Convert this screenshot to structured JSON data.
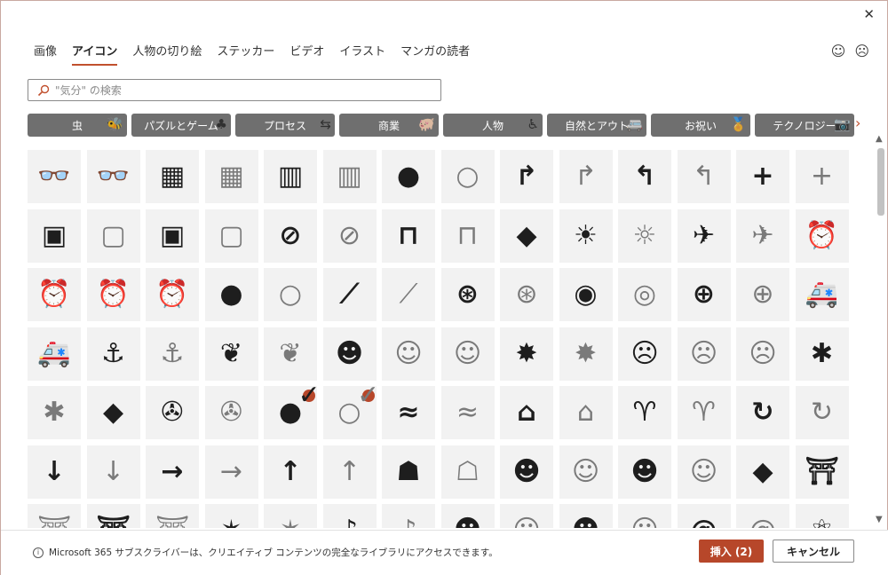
{
  "dialog": {
    "close_glyph": "✕"
  },
  "tabs": [
    {
      "label": "画像",
      "active": false
    },
    {
      "label": "アイコン",
      "active": true
    },
    {
      "label": "人物の切り絵",
      "active": false
    },
    {
      "label": "ステッカー",
      "active": false
    },
    {
      "label": "ビデオ",
      "active": false
    },
    {
      "label": "イラスト",
      "active": false
    },
    {
      "label": "マンガの読者",
      "active": false
    }
  ],
  "feedback": {
    "smile_glyph": "☺",
    "frown_glyph": "☹"
  },
  "search": {
    "icon": "search-icon",
    "placeholder": "\"気分\" の検索",
    "value": ""
  },
  "categories": [
    {
      "label": "虫",
      "icon": "bee-hive-icon",
      "glyph": "🐝"
    },
    {
      "label": "パズルとゲーム",
      "icon": "puzzle-icon",
      "glyph": "♣"
    },
    {
      "label": "プロセス",
      "icon": "process-arrows-icon",
      "glyph": "⇆"
    },
    {
      "label": "商業",
      "icon": "piggy-bank-icon",
      "glyph": "🐖"
    },
    {
      "label": "人物",
      "icon": "wheelchair-icon",
      "glyph": "♿"
    },
    {
      "label": "自然とアウト",
      "icon": "camper-icon",
      "glyph": "🚐"
    },
    {
      "label": "お祝い",
      "icon": "award-ribbon-icon",
      "glyph": "🏅"
    },
    {
      "label": "テクノロジー",
      "icon": "camera-icon",
      "glyph": "📷"
    }
  ],
  "categories_next_glyph": "›",
  "icon_grid": [
    [
      {
        "name": "3d-glasses-filled",
        "glyph": "👓",
        "style": "filled"
      },
      {
        "name": "3d-glasses-outline",
        "glyph": "👓",
        "style": "outline"
      },
      {
        "name": "abacus-filled",
        "glyph": "▦",
        "style": "filled"
      },
      {
        "name": "abacus-outline",
        "glyph": "▦",
        "style": "outline"
      },
      {
        "name": "abacus-2-filled",
        "glyph": "▥",
        "style": "filled"
      },
      {
        "name": "abacus-2-outline",
        "glyph": "▥",
        "style": "outline"
      },
      {
        "name": "acorn-filled",
        "glyph": "●",
        "style": "filled"
      },
      {
        "name": "acorn-outline",
        "glyph": "○",
        "style": "outline"
      },
      {
        "name": "arrow-turn-right-filled",
        "glyph": "↱",
        "style": "filled"
      },
      {
        "name": "arrow-turn-right-outline",
        "glyph": "↱",
        "style": "outline"
      },
      {
        "name": "arrow-turn-left-filled",
        "glyph": "↰",
        "style": "filled"
      },
      {
        "name": "arrow-turn-left-outline",
        "glyph": "↰",
        "style": "outline"
      },
      {
        "name": "add-filled",
        "glyph": "+",
        "style": "filled"
      },
      {
        "name": "add-outline",
        "glyph": "+",
        "style": "outline"
      }
    ],
    [
      {
        "name": "address-book-filled",
        "glyph": "▣",
        "style": "filled"
      },
      {
        "name": "address-book-outline",
        "glyph": "▢",
        "style": "outline"
      },
      {
        "name": "address-book-2-filled",
        "glyph": "▣",
        "style": "filled"
      },
      {
        "name": "address-book-2-outline",
        "glyph": "▢",
        "style": "outline"
      },
      {
        "name": "adhesive-bandage-filled",
        "glyph": "⊘",
        "style": "filled"
      },
      {
        "name": "adhesive-bandage-outline",
        "glyph": "⊘",
        "style": "outline"
      },
      {
        "name": "billboard-filled",
        "glyph": "⊓",
        "style": "filled"
      },
      {
        "name": "billboard-outline",
        "glyph": "⊓",
        "style": "outline"
      },
      {
        "name": "africa-filled",
        "glyph": "◆",
        "style": "filled"
      },
      {
        "name": "agriculture-filled",
        "glyph": "☀",
        "style": "filled"
      },
      {
        "name": "agriculture-outline",
        "glyph": "☼",
        "style": "outline"
      },
      {
        "name": "airplane-filled",
        "glyph": "✈",
        "style": "filled"
      },
      {
        "name": "airplane-outline",
        "glyph": "✈",
        "style": "outline"
      },
      {
        "name": "alarm-clock-filled",
        "glyph": "⏰",
        "style": "filled"
      }
    ],
    [
      {
        "name": "alarm-clock-outline",
        "glyph": "⏰",
        "style": "outline"
      },
      {
        "name": "alarm-ringing-filled",
        "glyph": "⏰",
        "style": "filled"
      },
      {
        "name": "alarm-ringing-outline",
        "glyph": "⏰",
        "style": "outline"
      },
      {
        "name": "alien-face-filled",
        "glyph": "●",
        "style": "filled"
      },
      {
        "name": "alien-face-outline",
        "glyph": "○",
        "style": "outline"
      },
      {
        "name": "needle-filled",
        "glyph": "⟋",
        "style": "filled"
      },
      {
        "name": "needle-outline",
        "glyph": "⟋",
        "style": "outline"
      },
      {
        "name": "yarn-filled",
        "glyph": "⊛",
        "style": "filled"
      },
      {
        "name": "yarn-outline",
        "glyph": "⊛",
        "style": "outline"
      },
      {
        "name": "measuring-tape-filled",
        "glyph": "◉",
        "style": "filled"
      },
      {
        "name": "measuring-tape-outline",
        "glyph": "◎",
        "style": "outline"
      },
      {
        "name": "button-filled",
        "glyph": "⊕",
        "style": "filled"
      },
      {
        "name": "button-outline",
        "glyph": "⊕",
        "style": "outline"
      },
      {
        "name": "ambulance-filled",
        "glyph": "🚑",
        "style": "filled"
      }
    ],
    [
      {
        "name": "ambulance-outline",
        "glyph": "🚑",
        "style": "outline"
      },
      {
        "name": "anchor-filled",
        "glyph": "⚓",
        "style": "filled"
      },
      {
        "name": "anchor-outline",
        "glyph": "⚓",
        "style": "outline"
      },
      {
        "name": "anemone-filled",
        "glyph": "❦",
        "style": "filled"
      },
      {
        "name": "anemone-outline",
        "glyph": "❦",
        "style": "outline"
      },
      {
        "name": "angel-face-filled",
        "glyph": "☻",
        "style": "filled"
      },
      {
        "name": "angel-face-outline",
        "glyph": "☺",
        "style": "outline"
      },
      {
        "name": "angel-face-2-outline",
        "glyph": "☺",
        "style": "outline"
      },
      {
        "name": "anger-symbol-filled",
        "glyph": "✸",
        "style": "filled"
      },
      {
        "name": "anger-symbol-outline",
        "glyph": "✸",
        "style": "outline"
      },
      {
        "name": "angry-face-filled",
        "glyph": "☹",
        "style": "filled"
      },
      {
        "name": "angry-face-outline",
        "glyph": "☹",
        "style": "outline"
      },
      {
        "name": "angry-face-2-outline",
        "glyph": "☹",
        "style": "outline"
      },
      {
        "name": "ant-filled",
        "glyph": "✱",
        "style": "filled"
      }
    ],
    [
      {
        "name": "ant-outline",
        "glyph": "✱",
        "style": "outline"
      },
      {
        "name": "antarctica-filled",
        "glyph": "◆",
        "style": "filled"
      },
      {
        "name": "aperture-filled",
        "glyph": "✇",
        "style": "filled"
      },
      {
        "name": "aperture-outline",
        "glyph": "✇",
        "style": "outline"
      },
      {
        "name": "apple-filled",
        "glyph": "●",
        "style": "filled",
        "selected": true
      },
      {
        "name": "apple-outline",
        "glyph": "○",
        "style": "outline",
        "selected": true
      },
      {
        "name": "aquarius-filled",
        "glyph": "≈",
        "style": "filled"
      },
      {
        "name": "aquarius-outline",
        "glyph": "≈",
        "style": "outline"
      },
      {
        "name": "architect-drawing-filled",
        "glyph": "⌂",
        "style": "filled"
      },
      {
        "name": "architect-drawing-outline",
        "glyph": "⌂",
        "style": "outline"
      },
      {
        "name": "aries-filled",
        "glyph": "♈",
        "style": "filled"
      },
      {
        "name": "aries-outline",
        "glyph": "♈",
        "style": "outline"
      },
      {
        "name": "recycle-arrows-filled",
        "glyph": "↻",
        "style": "filled"
      },
      {
        "name": "recycle-arrows-outline",
        "glyph": "↻",
        "style": "outline"
      }
    ],
    [
      {
        "name": "arrow-down-filled",
        "glyph": "↓",
        "style": "filled"
      },
      {
        "name": "arrow-down-outline",
        "glyph": "↓",
        "style": "outline"
      },
      {
        "name": "arrow-right-filled",
        "glyph": "→",
        "style": "filled"
      },
      {
        "name": "arrow-right-outline",
        "glyph": "→",
        "style": "outline"
      },
      {
        "name": "arrow-up-filled",
        "glyph": "↑",
        "style": "filled"
      },
      {
        "name": "arrow-up-outline",
        "glyph": "↑",
        "style": "outline"
      },
      {
        "name": "artificial-intelligence-filled",
        "glyph": "☗",
        "style": "filled"
      },
      {
        "name": "artificial-intelligence-outline",
        "glyph": "☖",
        "style": "outline"
      },
      {
        "name": "artist-female-filled",
        "glyph": "☻",
        "style": "filled"
      },
      {
        "name": "artist-female-outline",
        "glyph": "☺",
        "style": "outline"
      },
      {
        "name": "artist-male-filled",
        "glyph": "☻",
        "style": "filled"
      },
      {
        "name": "artist-male-outline",
        "glyph": "☺",
        "style": "outline"
      },
      {
        "name": "asia-filled",
        "glyph": "◆",
        "style": "filled"
      },
      {
        "name": "asian-temple-filled",
        "glyph": "⛩",
        "style": "filled"
      }
    ],
    [
      {
        "name": "asian-temple-outline",
        "glyph": "⛩",
        "style": "outline"
      },
      {
        "name": "asian-temple-2-filled",
        "glyph": "⛩",
        "style": "filled"
      },
      {
        "name": "asian-temple-2-outline",
        "glyph": "⛩",
        "style": "outline"
      },
      {
        "name": "astronomy-filled",
        "glyph": "✶",
        "style": "filled"
      },
      {
        "name": "astronomy-outline",
        "glyph": "✶",
        "style": "outline"
      },
      {
        "name": "athlete-filled",
        "glyph": "♪",
        "style": "filled"
      },
      {
        "name": "athlete-outline",
        "glyph": "♪",
        "style": "outline"
      },
      {
        "name": "astronaut-filled",
        "glyph": "☻",
        "style": "filled"
      },
      {
        "name": "astronaut-outline",
        "glyph": "☺",
        "style": "outline"
      },
      {
        "name": "astronaut-2-filled",
        "glyph": "☻",
        "style": "filled"
      },
      {
        "name": "astronaut-2-outline",
        "glyph": "☺",
        "style": "outline"
      },
      {
        "name": "at-sign-filled",
        "glyph": "@",
        "style": "filled"
      },
      {
        "name": "at-sign-outline",
        "glyph": "@",
        "style": "outline"
      },
      {
        "name": "atom-filled",
        "glyph": "⚛",
        "style": "filled"
      }
    ]
  ],
  "selected_badge_glyph": "✓",
  "scroll": {
    "up_glyph": "▲",
    "down_glyph": "▼"
  },
  "footer": {
    "info_glyph": "i",
    "info_text": "Microsoft 365 サブスクライバーは、クリエイティブ コンテンツの完全なライブラリにアクセスできます。",
    "insert_label": "挿入 (2)",
    "cancel_label": "キャンセル"
  },
  "colors": {
    "accent": "#b7472a",
    "category_bg": "#6f6f6f",
    "tile_bg": "#f2f2f2"
  }
}
